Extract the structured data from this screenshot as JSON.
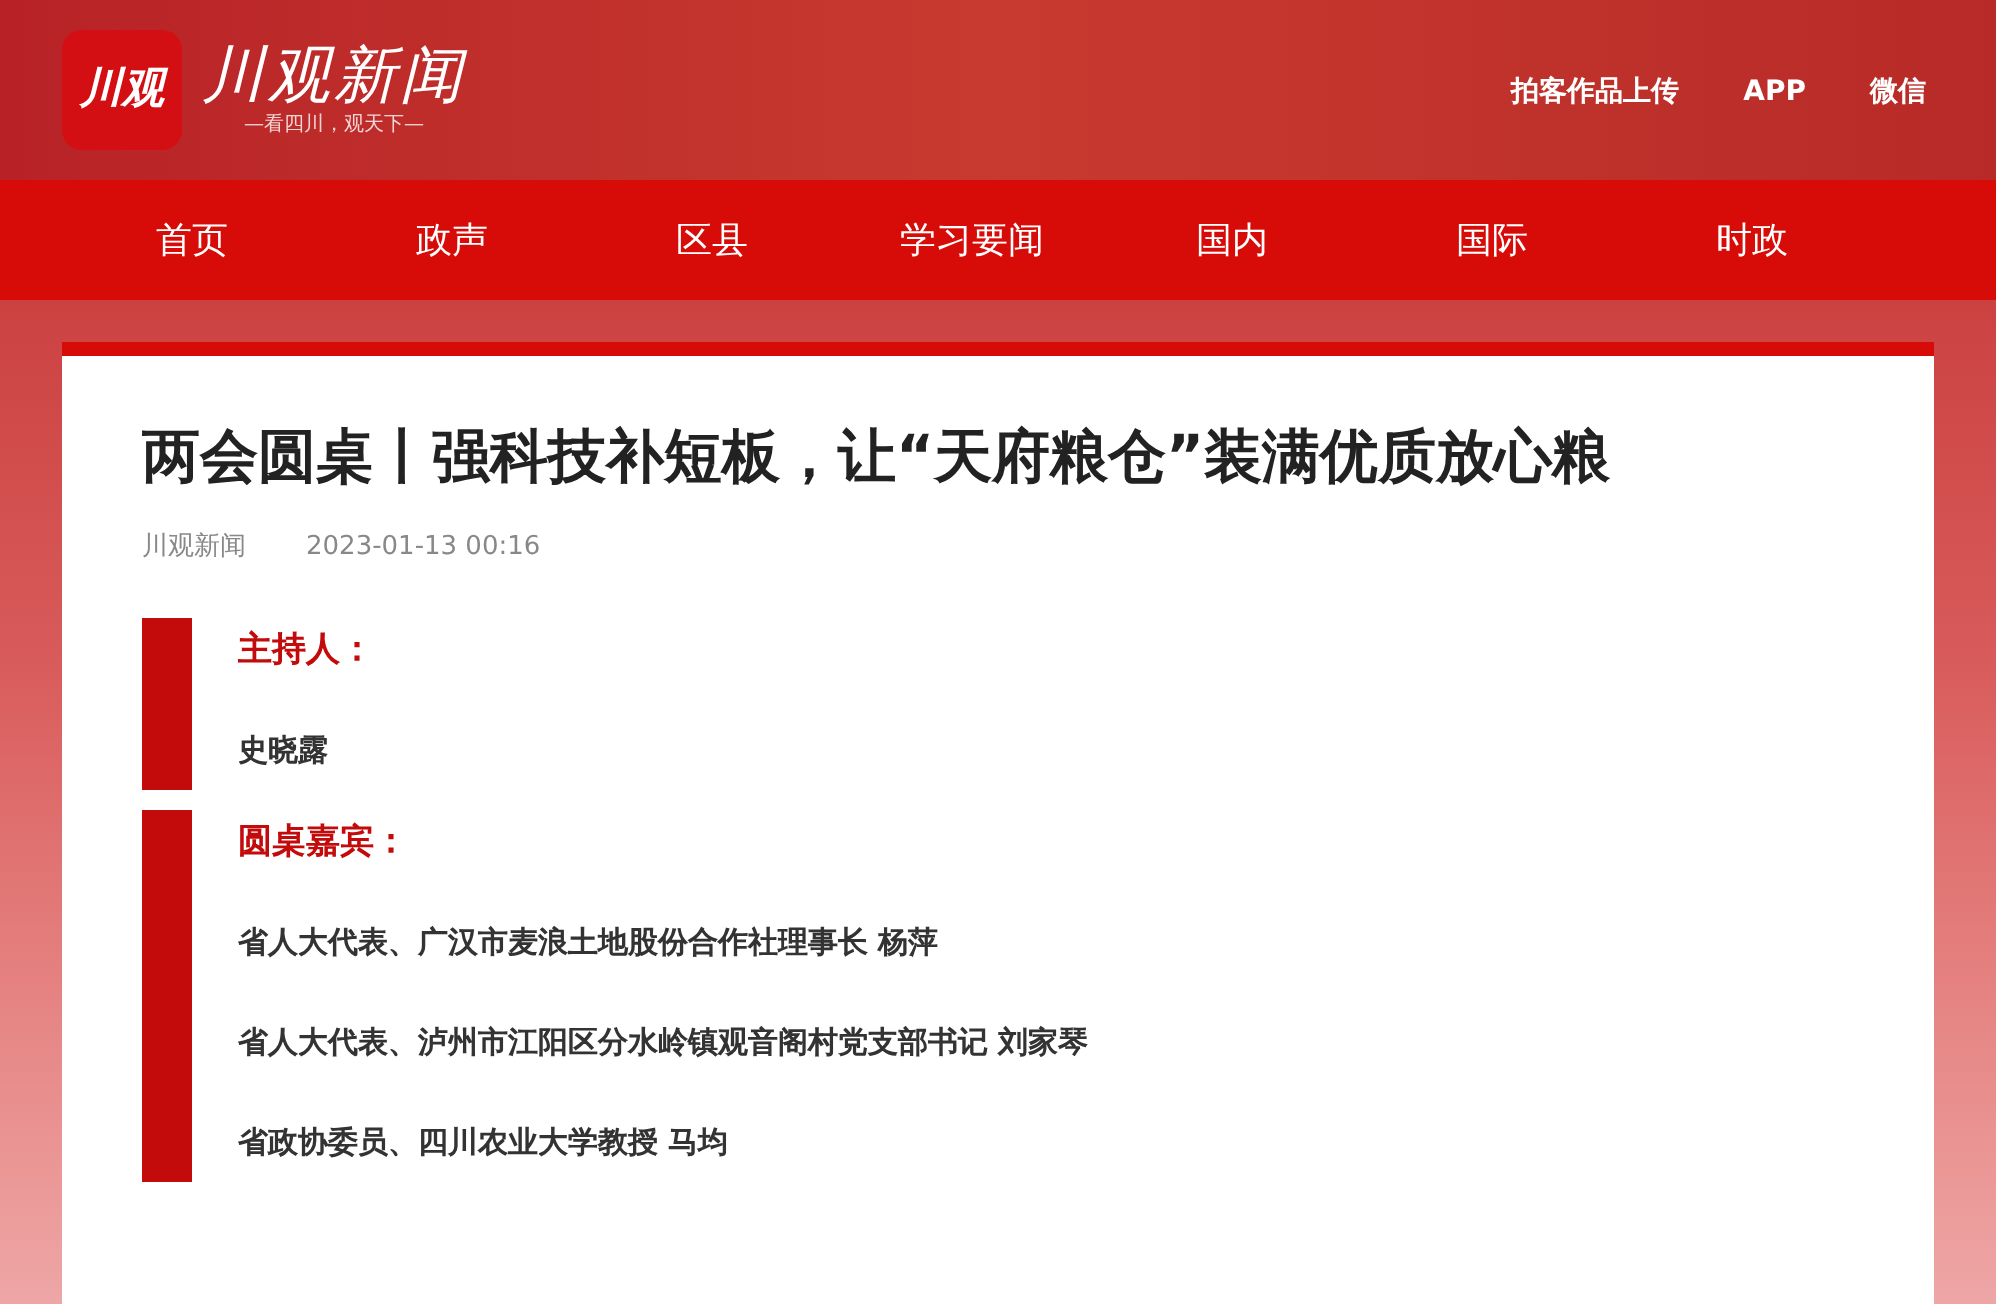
{
  "header": {
    "logo_mark": "川观",
    "logo_title": "川观新闻",
    "logo_slogan": "—看四川，观天下—",
    "links": [
      "拍客作品上传",
      "APP",
      "微信"
    ]
  },
  "nav": [
    {
      "label": "首页"
    },
    {
      "label": "政声"
    },
    {
      "label": "区县"
    },
    {
      "label": "学习要闻"
    },
    {
      "label": "国内"
    },
    {
      "label": "国际"
    },
    {
      "label": "时政"
    }
  ],
  "article": {
    "title": "两会圆桌丨强科技补短板，让“天府粮仓”装满优质放心粮",
    "source": "川观新闻",
    "date": "2023-01-13 00:16",
    "blocks": [
      {
        "heading": "主持人：",
        "lines": [
          "史晓露"
        ]
      },
      {
        "heading": "圆桌嘉宾：",
        "lines": [
          "省人大代表、广汉市麦浪土地股份合作社理事长 杨萍",
          "省人大代表、泸州市江阳区分水岭镇观音阁村党支部书记 刘家琴",
          "省政协委员、四川农业大学教授 马均"
        ]
      }
    ]
  }
}
